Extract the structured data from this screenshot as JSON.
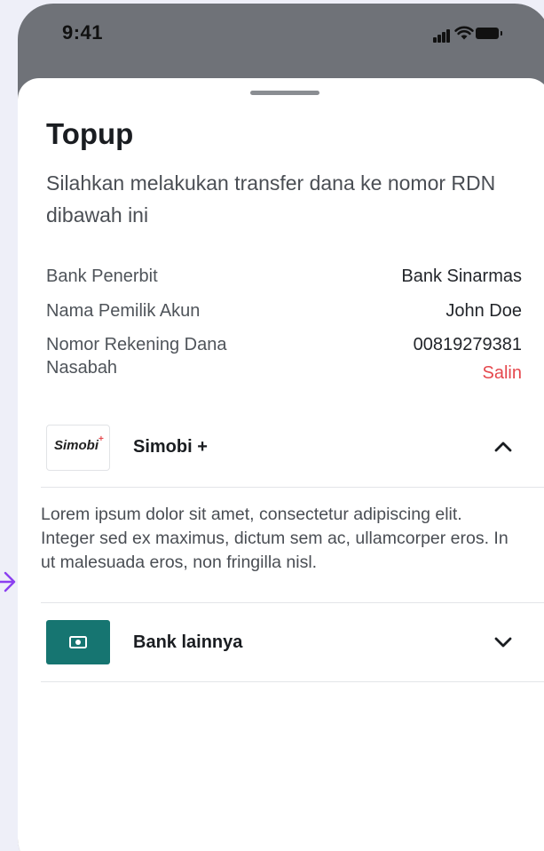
{
  "status_bar": {
    "time": "9:41"
  },
  "sheet": {
    "title": "Topup",
    "subtitle": "Silahkan melakukan transfer dana ke nomor RDN dibawah ini",
    "details": {
      "bank_label": "Bank Penerbit",
      "bank_value": "Bank Sinarmas",
      "owner_label": "Nama Pemilik Akun",
      "owner_value": "John Doe",
      "account_label": "Nomor Rekening Dana Nasabah",
      "account_value": "00819279381",
      "copy_label": "Salin"
    },
    "accordions": [
      {
        "logo_text": "Simobi",
        "logo_mark": "+",
        "title": "Simobi +",
        "icon": "chevron-up-icon",
        "expanded": true,
        "body": "Lorem ipsum dolor sit amet, consectetur adipiscing elit. Integer sed ex maximus, dictum sem ac, ullamcorper eros. In ut malesuada eros, non fringilla nisl."
      },
      {
        "title": "Bank lainnya",
        "icon": "chevron-down-icon",
        "logo_icon": "money-icon",
        "expanded": false
      }
    ]
  },
  "colors": {
    "accent_red": "#e5484d",
    "bank_teal": "#167571",
    "arrow_purple": "#8b3ff0"
  }
}
